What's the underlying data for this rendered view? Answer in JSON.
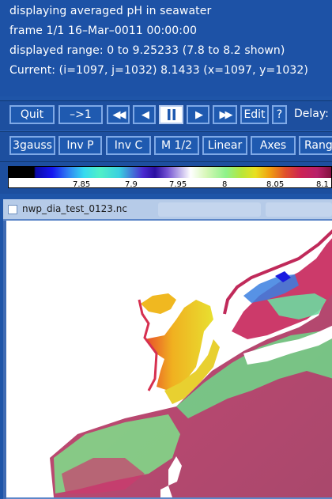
{
  "info": {
    "line1": "displaying averaged pH in seawater",
    "line2": "frame 1/1 16–Mar–0011 00:00:00",
    "line3": "displayed range: 0 to 9.25233 (7.8 to 8.2 shown)",
    "line4": "Current: (i=1097, j=1032) 8.1433 (x=1097, y=1032)"
  },
  "toolbar1": {
    "quit": "Quit",
    "step": "–>1",
    "rewind_icon": "rewind-icon",
    "back_icon": "step-back-icon",
    "pause_icon": "pause-icon",
    "forward_icon": "step-forward-icon",
    "fastforward_icon": "fast-forward-icon",
    "edit": "Edit",
    "help": "?",
    "delay": "Delay:"
  },
  "toolbar2": {
    "b1": "3gauss",
    "b2": "Inv P",
    "b3": "Inv C",
    "b4": "M 1/2",
    "b5": "Linear",
    "b6": "Axes",
    "b7": "Rang"
  },
  "colorbar": {
    "ticks": [
      "7.85",
      "7.9",
      "7.95",
      "8",
      "8.05",
      "8.1"
    ]
  },
  "subwindow": {
    "title": "nwp_dia_test_0123.nc"
  },
  "colors": {
    "panel": "#1d52a6",
    "button_border": "#7fa9e6",
    "land": "#ffffff"
  }
}
